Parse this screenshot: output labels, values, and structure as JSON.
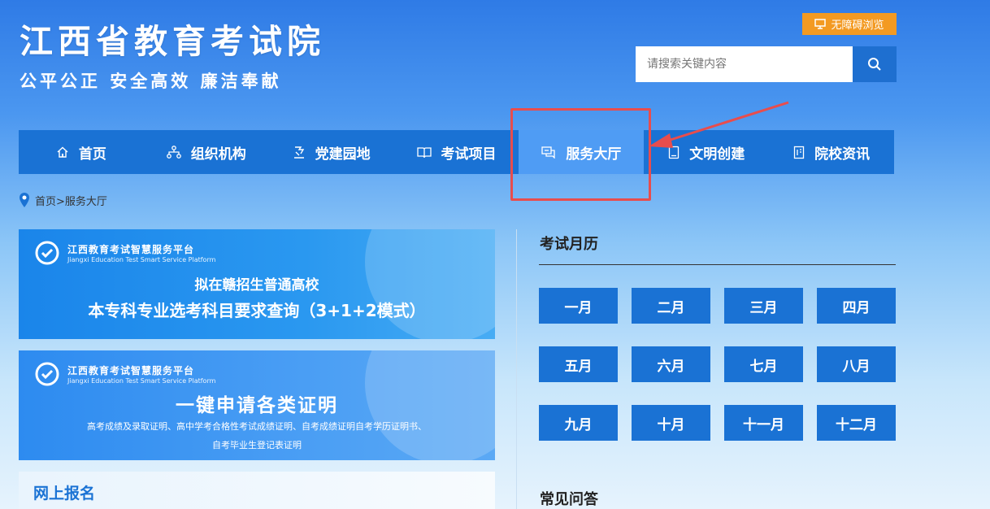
{
  "header": {
    "title": "江西省教育考试院",
    "slogan": "公平公正  安全高效  廉洁奉献",
    "accessibility_label": "无障碍浏览",
    "search_placeholder": "请搜索关键内容"
  },
  "nav": {
    "items": [
      {
        "label": "首页",
        "icon": "home-icon"
      },
      {
        "label": "组织机构",
        "icon": "org-chart-icon"
      },
      {
        "label": "党建园地",
        "icon": "party-building-icon"
      },
      {
        "label": "考试项目",
        "icon": "book-icon"
      },
      {
        "label": "服务大厅",
        "icon": "chat-service-icon",
        "active": true
      },
      {
        "label": "文明创建",
        "icon": "document-icon"
      },
      {
        "label": "院校资讯",
        "icon": "news-icon"
      }
    ]
  },
  "breadcrumb": {
    "text": "首页>服务大厅"
  },
  "banners": [
    {
      "logo_cn": "江西教育考试智慧服务平台",
      "logo_en": "Jiangxi Education Test Smart Service Platform",
      "line1": "拟在赣招生普通高校",
      "line2": "本专科专业选考科目要求查询（3+1+2模式）"
    },
    {
      "logo_cn": "江西教育考试智慧服务平台",
      "logo_en": "Jiangxi Education Test Smart Service Platform",
      "line1": "一键申请各类证明",
      "line2": "高考成绩及录取证明、高中学考合格性考试成绩证明、自考成绩证明自考学历证明书、",
      "line3": "自考毕业生登记表证明"
    }
  ],
  "online_registration": {
    "title": "网上报名"
  },
  "exam_calendar": {
    "title": "考试月历",
    "months": [
      "一月",
      "二月",
      "三月",
      "四月",
      "五月",
      "六月",
      "七月",
      "八月",
      "九月",
      "十月",
      "十一月",
      "十二月"
    ]
  },
  "faq": {
    "title": "常见问答"
  },
  "colors": {
    "nav_bg": "#1a72d4",
    "nav_active": "#4f9cf4",
    "accent_orange": "#f39a22",
    "highlight_red": "#e84d4d"
  }
}
